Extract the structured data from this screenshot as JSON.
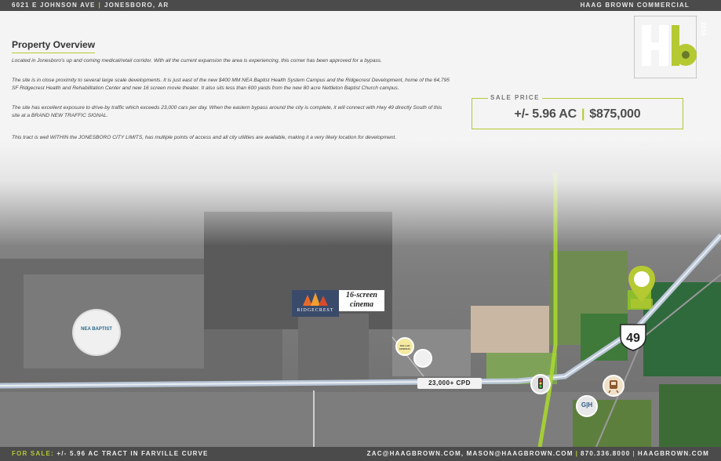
{
  "header": {
    "address": "6021 E JOHNSON AVE",
    "city": "JONESBORO, AR",
    "brand": "HAAG BROWN COMMERCIAL"
  },
  "overview": {
    "title": "Property Overview",
    "paragraphs": [
      "Located in Jonesboro's up and coming medical/retail corridor. With all the current expansion the area is experiencing, this corner has been approved for a bypass.",
      "The site is in close proximity to several large scale developments. It is just east of the new $400 MM NEA Baptist Health System Campus and the Ridgecrest Development, home of the 64,795 SF Ridgecrest Health and Rehabilitation Center and new 16 screen movie theater. It also sits less than 600 yards from the new 80 acre Nettleton Baptist Church campus.",
      "The site has excellent exposure to drive-by traffic which exceeds 23,000 cars per day. When the eastern bypass around the city is complete, it will connect with Hwy 49 directly South of this site at a BRAND NEW TRAFFIC SIGNAL.",
      "This tract is well WITHIN the JONESBORO CITY LIMITS, has multiple points of access and all city utilities are available, making it a very likely location for development."
    ]
  },
  "sale": {
    "label": "SALE PRICE",
    "acres": "+/- 5.96 AC",
    "price": "$875,000"
  },
  "logo": {
    "letters": "Hb",
    "year": "2016"
  },
  "map": {
    "callout_line1": "16-screen",
    "callout_line2": "cinema",
    "ridgecrest": "RIDGECREST",
    "nea": "NEA BAPTIST",
    "dollar_general": "DOLLAR GENERAL",
    "gh": "G|H",
    "traffic": "23,000+ CPD",
    "highway": "49"
  },
  "footer": {
    "for_sale_label": "FOR SALE:",
    "for_sale_text": "+/- 5.96 AC TRACT IN FARVILLE CURVE",
    "contact_emails": "ZAC@HAAGBROWN.COM, MASON@HAAGBROWN.COM",
    "phone": "870.336.8000",
    "website": "HAAGBROWN.COM"
  },
  "colors": {
    "accent": "#b5c932",
    "bar": "#4b4b4b"
  }
}
